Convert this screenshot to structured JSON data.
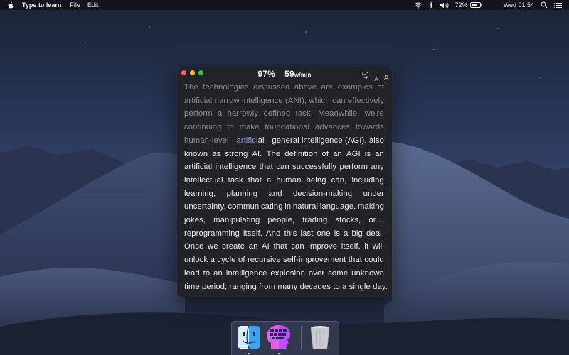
{
  "menubar": {
    "app_name": "Type to learn",
    "menus": [
      "File",
      "Edit"
    ],
    "battery_percent": "72%",
    "clock": "Wed 01:54",
    "icons": [
      "apple-icon",
      "wifi-icon",
      "bluetooth-icon",
      "volume-icon",
      "battery-icon",
      "flag-icon",
      "search-icon",
      "menu-list-icon"
    ],
    "flag_colors": [
      "#d52b1e",
      "#ffffff",
      "#d52b1e"
    ]
  },
  "window": {
    "stats": {
      "accuracy": "97%",
      "speed": "59",
      "speed_unit": "w/min"
    },
    "tools": {
      "font_small": "A",
      "font_large": "A"
    },
    "colors": {
      "typed": "#8b8c92",
      "current_word": "#8f8fe8",
      "untyped": "#ebebee",
      "background": "#222326"
    },
    "passage": {
      "typed_lines": [
        "The technologies discussed above are examples of",
        "artificial narrow intelligence (ANI), which can effectively",
        "perform a narrowly defined task. Meanwhile, we're",
        "continuing to make foundational advances towards"
      ],
      "cursor_line": {
        "typed_before": "human-level",
        "current_word_typed": "artifici",
        "current_word_rest": "al",
        "rest_of_line": "general intelligence (AGI), also"
      },
      "untyped_lines": [
        "known as strong AI. The definition of an AGI is an",
        "artificial intelligence that can successfully perform any",
        "intellectual task that a human being can, including",
        "learning, planning and decision-making under",
        "uncertainty, communicating in natural language, making",
        "jokes, manipulating people, trading stocks, or…",
        "reprogramming itself. And this last one is a big deal.",
        "Once we create an AI that can improve itself, it will",
        "unlock a cycle of recursive self-improvement that could",
        "lead to an intelligence explosion over some unknown"
      ],
      "last_line": "time period, ranging from many decades to a single day."
    }
  },
  "dock": {
    "items": [
      "Finder",
      "Type to learn",
      "Trash"
    ],
    "icons": [
      "finder-icon",
      "brain-keyboard-icon",
      "trash-icon"
    ]
  }
}
